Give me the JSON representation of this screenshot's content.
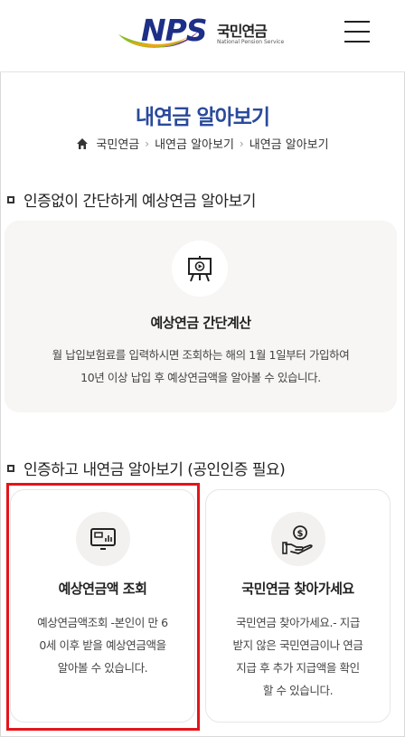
{
  "header": {
    "logo_mark": "NPS",
    "logo_name_ko": "국민연금",
    "logo_name_en": "National Pension Service",
    "menu_icon": "hamburger-icon"
  },
  "page": {
    "title": "내연금 알아보기",
    "breadcrumb": [
      "국민연금",
      "내연금 알아보기",
      "내연금 알아보기"
    ]
  },
  "section1": {
    "title": "인증없이 간단하게 예상연금 알아보기",
    "card": {
      "icon": "presentation-board-icon",
      "title": "예상연금 간단계산",
      "desc_lines": [
        "월 납입보험료를 입력하시면 조회하는 해의 1월 1일부터 가입하여",
        "10년 이상 납입 후 예상연금액을 알아볼 수 있습니다."
      ]
    }
  },
  "section2": {
    "title": "인증하고 내연금 알아보기 (공인인증 필요)",
    "cards": [
      {
        "icon": "monitor-chart-icon",
        "title": "예상연금액 조회",
        "desc_lines": [
          "예상연금액조회 -본인이 만 6",
          "0세 이후 받을 예상연금액을",
          "알아볼 수 있습니다."
        ]
      },
      {
        "icon": "hand-coin-icon",
        "title": "국민연금 찾아가세요",
        "desc_lines": [
          "국민연금 찾아가세요.- 지급",
          "받지 않은 국민연금이나 연금",
          "지급 후 추가 지급액을 확인",
          "할 수 있습니다."
        ]
      }
    ]
  },
  "colors": {
    "title_blue": "#2a4a9b",
    "logo_navy": "#1d2f86",
    "highlight_red": "#e4141b",
    "card_bg": "#f7f6f4"
  }
}
